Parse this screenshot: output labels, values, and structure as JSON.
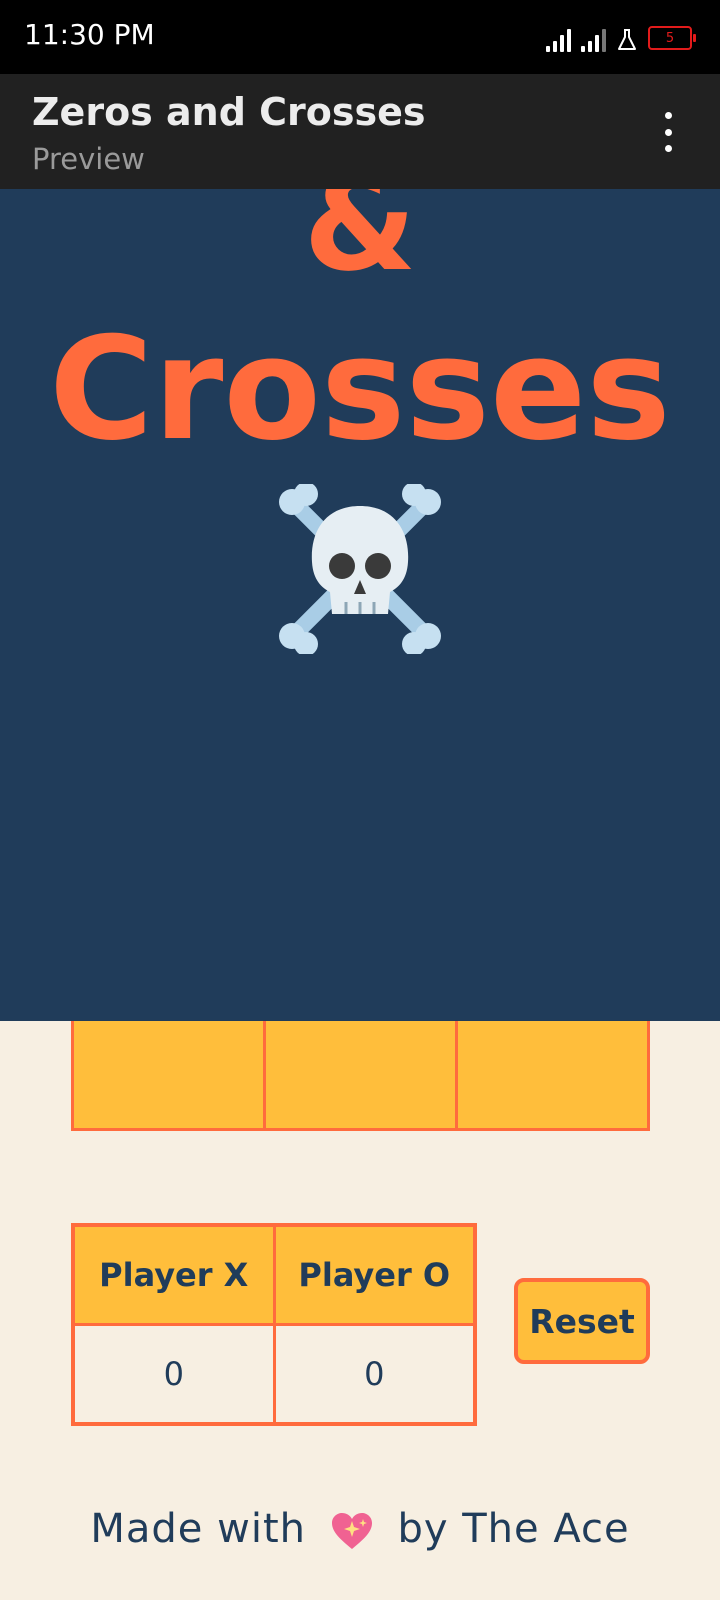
{
  "status_bar": {
    "time": "11:30 PM",
    "battery_level": "5",
    "icons": [
      "signal-icon",
      "signal-icon",
      "flask-icon",
      "battery-icon"
    ]
  },
  "app_bar": {
    "title": "Zeros and Crosses",
    "subtitle": "Preview",
    "menu_icon": "more-vert-icon"
  },
  "hero": {
    "ampersand": "&",
    "title_word": "Crosses",
    "emoji_icon": "skull-and-crossbones-icon"
  },
  "board": {
    "visible_row": [
      "",
      "",
      ""
    ]
  },
  "scoreboard": {
    "headers": [
      "Player X",
      "Player O"
    ],
    "scores": [
      "0",
      "0"
    ]
  },
  "reset_label": "Reset",
  "footer": {
    "prefix": "Made with",
    "icon": "sparkling-heart-icon",
    "suffix": "by The Ace"
  },
  "colors": {
    "status_bar": "#000000",
    "app_bar": "#212121",
    "hero_bg": "#203c5a",
    "accent_orange": "#ff6b3d",
    "cell_yellow": "#ffbe3b",
    "page_bg": "#f7efe2",
    "text_navy": "#203c5a"
  }
}
